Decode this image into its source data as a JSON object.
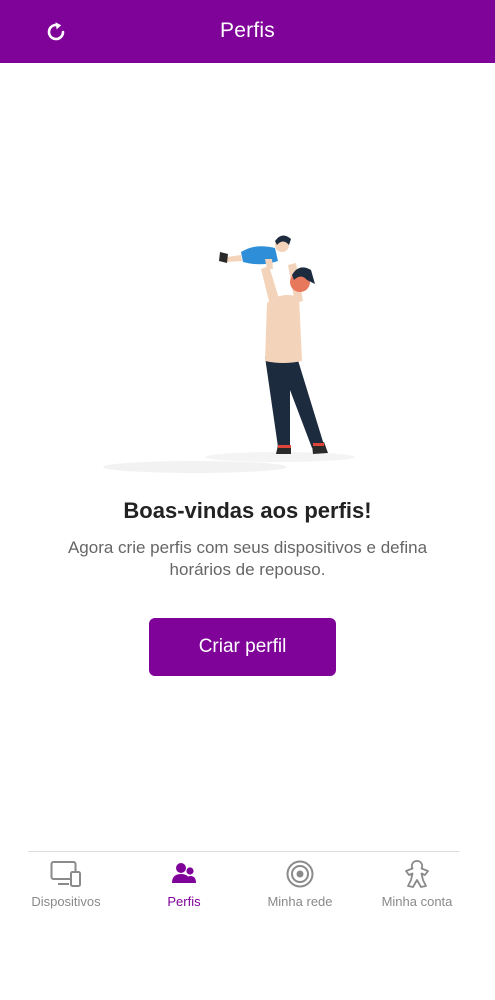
{
  "app_bar": {
    "title": "Perfis",
    "refresh_icon": "refresh-icon",
    "background": "#800399"
  },
  "empty_state": {
    "illustration": "father-lifting-child-illustration",
    "title": "Boas-vindas aos perfis!",
    "description": "Agora crie perfis com seus dispositivos e defina horários de repouso.",
    "button_label": "Criar perfil"
  },
  "bottom_nav": {
    "active_color": "#800399",
    "inactive_color": "#8a8a8a",
    "items": [
      {
        "label": "Dispositivos",
        "icon": "devices-icon",
        "active": false
      },
      {
        "label": "Perfis",
        "icon": "profiles-icon",
        "active": true
      },
      {
        "label": "Minha rede",
        "icon": "network-icon",
        "active": false
      },
      {
        "label": "Minha conta",
        "icon": "account-icon",
        "active": false
      }
    ]
  }
}
